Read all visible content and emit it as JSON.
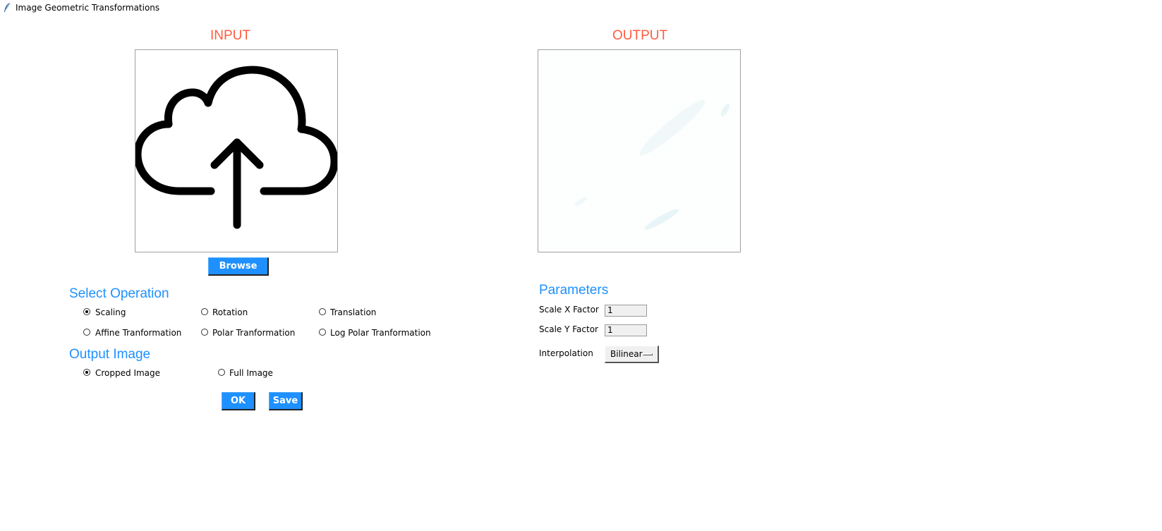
{
  "window": {
    "title": "Image Geometric Transformations",
    "icon": "feather-icon"
  },
  "input_panel": {
    "heading": "INPUT",
    "placeholder_icon": "cloud-upload-icon",
    "browse_label": "Browse"
  },
  "output_panel": {
    "heading": "OUTPUT"
  },
  "operation": {
    "heading": "Select Operation",
    "options": [
      {
        "label": "Scaling",
        "checked": true
      },
      {
        "label": "Rotation",
        "checked": false
      },
      {
        "label": "Translation",
        "checked": false
      },
      {
        "label": "Affine Tranformation",
        "checked": false
      },
      {
        "label": "Polar Tranformation",
        "checked": false
      },
      {
        "label": "Log Polar Tranformation",
        "checked": false
      }
    ]
  },
  "output_image": {
    "heading": "Output Image",
    "options": [
      {
        "label": "Cropped Image",
        "checked": true
      },
      {
        "label": "Full Image",
        "checked": false
      }
    ]
  },
  "actions": {
    "ok_label": "OK",
    "save_label": "Save"
  },
  "parameters": {
    "heading": "Parameters",
    "scale_x": {
      "label": "Scale X Factor",
      "value": "1"
    },
    "scale_y": {
      "label": "Scale Y Factor",
      "value": "1"
    },
    "interpolation": {
      "label": "Interpolation",
      "value": "Bilinear"
    }
  },
  "colors": {
    "accent_blue": "#1e90ff",
    "heading_red": "#ff5c3f"
  }
}
